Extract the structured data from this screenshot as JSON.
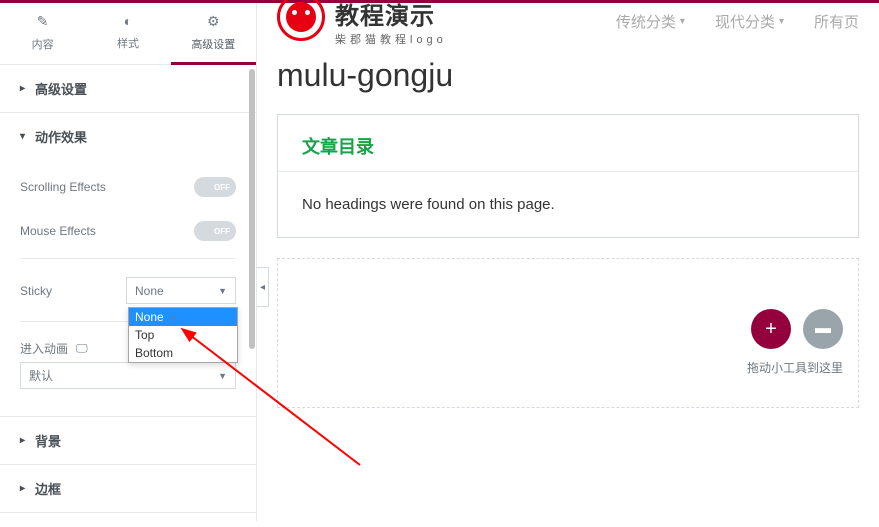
{
  "tabs": {
    "content": "内容",
    "style": "样式",
    "advanced": "高级设置"
  },
  "sections": {
    "advanced_settings": "高级设置",
    "motion_effects": "动作效果",
    "background": "背景",
    "border": "边框"
  },
  "controls": {
    "scrolling_effects_label": "Scrolling Effects",
    "mouse_effects_label": "Mouse Effects",
    "sticky_label": "Sticky",
    "entrance_animation_label": "进入动画",
    "toggle_off": "OFF",
    "sticky_value": "None",
    "sticky_options": [
      "None",
      "Top",
      "Bottom"
    ],
    "entrance_value": "默认"
  },
  "header": {
    "logo_title": "教程演示",
    "logo_subtitle": "柴郡猫教程logo",
    "nav_traditional": "传统分类",
    "nav_modern": "现代分类",
    "nav_all": "所有页"
  },
  "page": {
    "title": "mulu-gongju",
    "toc_title": "文章目录",
    "toc_empty": "No headings were found on this page.",
    "drop_hint": "拖动小工具到这里"
  }
}
